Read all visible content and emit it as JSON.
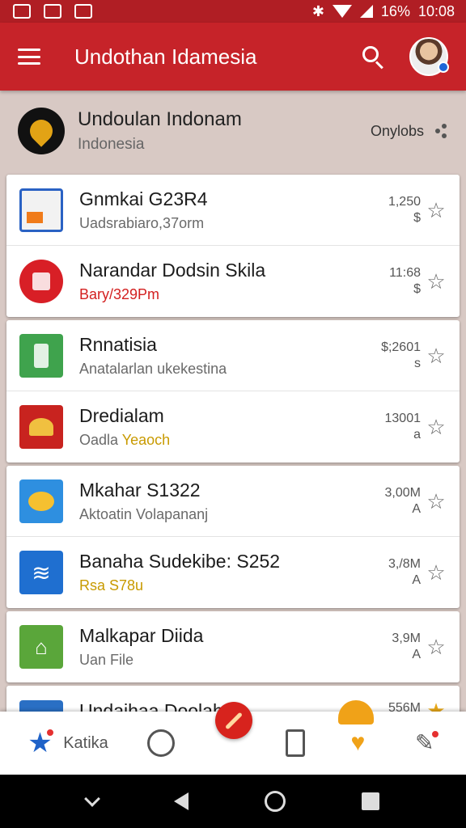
{
  "status": {
    "battery": "16%",
    "time": "10:08"
  },
  "appbar": {
    "title": "Undothan Idamesia"
  },
  "header": {
    "title": "Undoulan Indonam",
    "subtitle": "Indonesia",
    "action": "Onylobs"
  },
  "items": [
    {
      "title": "Gnmkai G23R4",
      "subtitle": "Uadsrabiaro,37orm",
      "meta1": "1,250",
      "meta2": "$",
      "color": "#e8e8e8"
    },
    {
      "title": "Narandar Dodsin Skila",
      "subtitle": "Bary/329Pm",
      "meta1": "11:68",
      "meta2": "$",
      "color": "#d81f26"
    },
    {
      "title": "Rnnatisia",
      "subtitle": "Anatalarlan ukekestina",
      "meta1": "$;2601",
      "meta2": "s",
      "color": "#3fa34d"
    },
    {
      "title": "Dredialam",
      "subtitle_a": "Oadla ",
      "subtitle_b": "Yeaoch",
      "meta1": "13001",
      "meta2": "a",
      "color": "#c8231f"
    },
    {
      "title": "Mkahar S1322",
      "subtitle": "Aktoatin Volapananj",
      "meta1": "3,00M",
      "meta2": "A",
      "color": "#2e8fe0"
    },
    {
      "title": "Banaha Sudekibe: S252",
      "subtitle": "Rsa S78u",
      "meta1": "3,/8M",
      "meta2": "A",
      "color": "#1f6fd0"
    },
    {
      "title": "Malkapar Diida",
      "subtitle": "Uan File",
      "meta1": "3,9M",
      "meta2": "A",
      "color": "#5aa63a"
    },
    {
      "title": "Undaihaa Doolaha",
      "meta1": "556M",
      "color": "#2a6fc4"
    }
  ],
  "bottomnav": {
    "label": "Katika"
  }
}
